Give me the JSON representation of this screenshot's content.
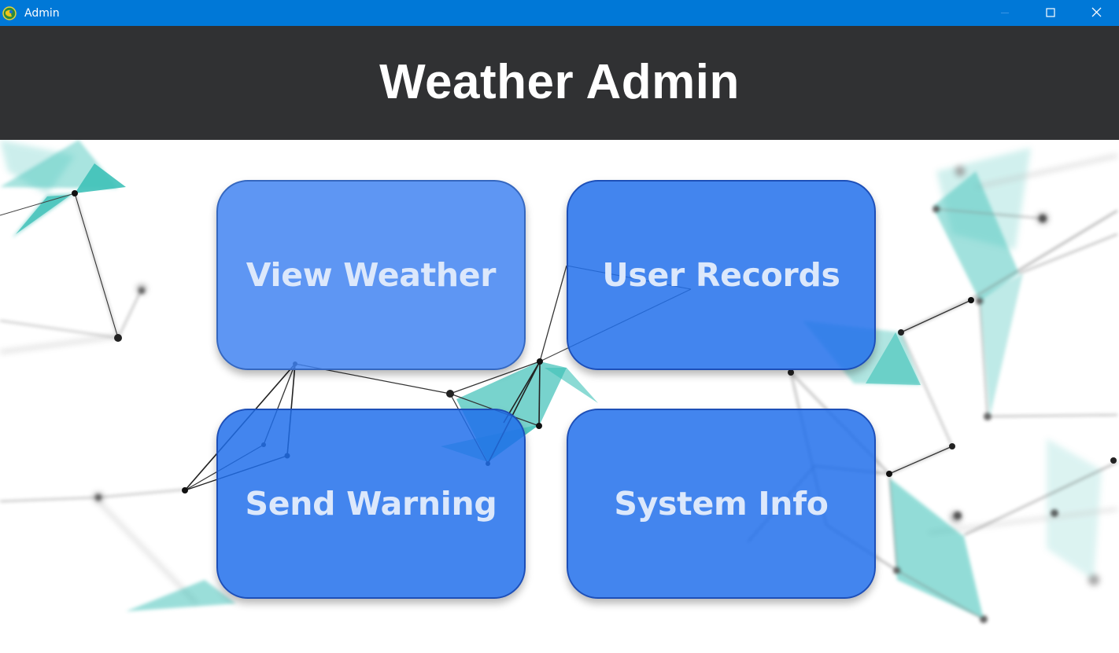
{
  "window": {
    "title": "Admin",
    "titlebar_color": "#0078d7",
    "icons": [
      "app-icon",
      "minimize-icon",
      "maximize-icon",
      "close-icon"
    ]
  },
  "header": {
    "title": "Weather Admin",
    "background_color": "#303133"
  },
  "tiles": [
    {
      "label": "View Weather"
    },
    {
      "label": "User Records"
    },
    {
      "label": "Send Warning"
    },
    {
      "label": "System Info"
    }
  ],
  "colors": {
    "tile_fill": "#1f6eeb",
    "tile_border": "#1d4fb8",
    "tile_text": "#dce8fb",
    "accent_teal": "#3ec1b8"
  }
}
